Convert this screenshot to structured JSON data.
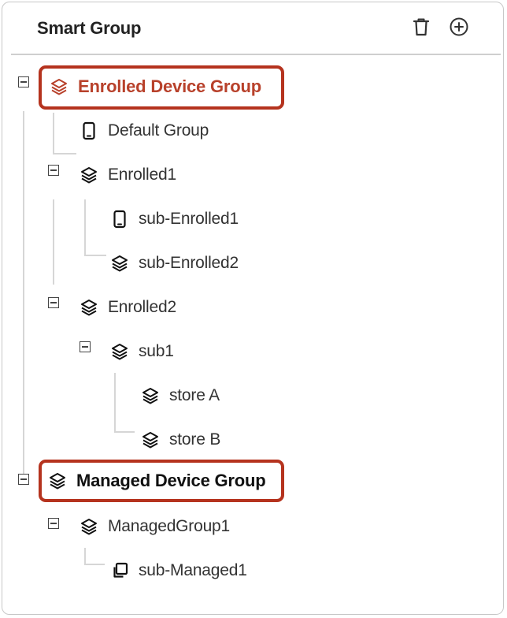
{
  "header": {
    "title": "Smart Group",
    "delete_icon": "trash-icon",
    "add_icon": "plus-circle-icon"
  },
  "tree": {
    "enrolled_root": "Enrolled Device Group",
    "default_group": "Default Group",
    "enrolled1": "Enrolled1",
    "sub_enrolled1": "sub-Enrolled1",
    "sub_enrolled2": "sub-Enrolled2",
    "enrolled2": "Enrolled2",
    "sub1": "sub1",
    "store_a": "store A",
    "store_b": "store B",
    "managed_root": "Managed Device Group",
    "managed_group1": "ManagedGroup1",
    "sub_managed1": "sub-Managed1"
  },
  "colors": {
    "highlight_border": "#b5331e",
    "enrolled_root_text": "#b8412b"
  }
}
